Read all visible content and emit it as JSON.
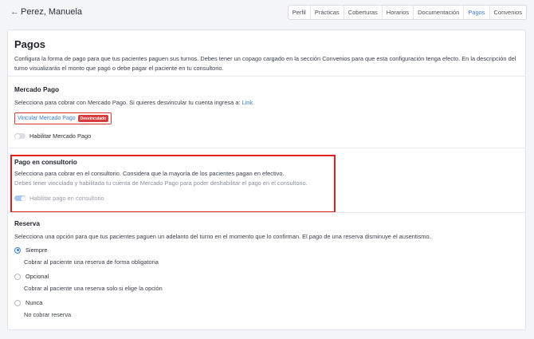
{
  "header": {
    "back_icon": "←",
    "patient_name": "Perez, Manuela",
    "tabs": [
      {
        "label": "Perfil",
        "active": false
      },
      {
        "label": "Prácticas",
        "active": false
      },
      {
        "label": "Coberturas",
        "active": false
      },
      {
        "label": "Horarios",
        "active": false
      },
      {
        "label": "Documentación",
        "active": false
      },
      {
        "label": "Pagos",
        "active": true
      },
      {
        "label": "Convenios",
        "active": false
      }
    ]
  },
  "page": {
    "title": "Pagos",
    "description": "Configura la forma de pago para que tus pacientes paguen sus turnos. Debes tener un copago cargado en la sección Convenios para que esta configuración tenga efecto. En la descripción del turno visualizarás el monto que pagó o debe pagar el paciente en tu consultorio."
  },
  "mercado_pago": {
    "title": "Mercado Pago",
    "text": "Selecciona para cobrar con Mercado Pago. Si quieres desvincular tu cuenta ingresa a:",
    "link": "Link",
    "button_label": "Vincular Mercado Pago",
    "badge": "Desvinculado",
    "toggle_label": "Habilitar Mercado Pago",
    "toggle_on": false
  },
  "consultorio": {
    "title": "Pago en consultorio",
    "text": "Selecciona para cobrar en el consultorio. Considera que la mayoría de los pacientes pagan en efectivo.",
    "note": "Debes tener vinculada y habilitada tu cuenta de Mercado Pago para poder deshabilitar el pago en el consultorio.",
    "toggle_label": "Habilitar pago en consultorio",
    "toggle_on": true
  },
  "reserva": {
    "title": "Reserva",
    "text": "Selecciona una opción para que tus pacientes paguen un adelanto del turno en el momento que lo confirman. El pago de una reserva disminuye el ausentismo.",
    "options": [
      {
        "label": "Siempre",
        "sub": "Cobrar al paciente una reserva de forma obligatoria",
        "checked": true
      },
      {
        "label": "Opcional",
        "sub": "Cobrar al paciente una reserva solo si elige la opción",
        "checked": false
      },
      {
        "label": "Nunca",
        "sub": "No cobrar reserva",
        "checked": false
      }
    ]
  },
  "colors": {
    "accent": "#3a7bd5",
    "badge_red": "#d93a3a",
    "highlight_red": "#e0201f"
  }
}
